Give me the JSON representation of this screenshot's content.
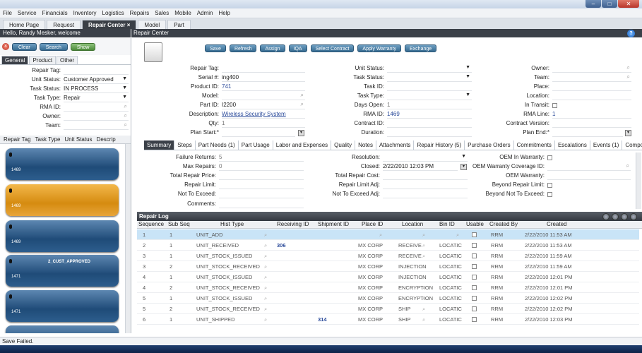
{
  "window": {
    "min": "–",
    "max": "□",
    "close": "✕"
  },
  "menu": [
    "File",
    "Service",
    "Financials",
    "Inventory",
    "Logistics",
    "Repairs",
    "Sales",
    "Mobile",
    "Admin",
    "Help"
  ],
  "tabs": [
    {
      "label": "Home Page"
    },
    {
      "label": "Request"
    },
    {
      "label": "Repair Center"
    },
    {
      "label": "Model"
    },
    {
      "label": "Part"
    }
  ],
  "tab_close": "×",
  "left_header": "Hello, Randy Mesker, welcome",
  "right_header": "Repair Center",
  "left_buttons": {
    "clear": "Clear",
    "search": "Search",
    "show": "Show"
  },
  "left_tabs": [
    "General",
    "Product",
    "Other"
  ],
  "left_form": [
    {
      "label": "Repair Tag:",
      "value": ""
    },
    {
      "label": "Unit Status:",
      "value": "Customer Approved",
      "kind": "dropdown"
    },
    {
      "label": "Task Status:",
      "value": "IN PROCESS",
      "kind": "dropdown"
    },
    {
      "label": "Task Type:",
      "value": "Repair",
      "kind": "dropdown"
    },
    {
      "label": "RMA ID:",
      "value": "",
      "kind": "lookup"
    },
    {
      "label": "Owner:",
      "value": "",
      "kind": "lookup"
    },
    {
      "label": "Team:",
      "value": "",
      "kind": "lookup"
    }
  ],
  "left_grid_cols": [
    "Repair Tag",
    "Task Type",
    "Unit Status",
    "Descrip"
  ],
  "cards": [
    {
      "id": "1469",
      "title": "",
      "color": "blue"
    },
    {
      "id": "1469",
      "title": "",
      "color": "orange"
    },
    {
      "id": "1469",
      "title": "",
      "color": "blue"
    },
    {
      "id": "1471",
      "title": "2_CUST_APPROVED",
      "color": "blue"
    },
    {
      "id": "1471",
      "title": "",
      "color": "blue"
    }
  ],
  "toolbar": [
    "Save",
    "Refresh",
    "Assign",
    "IQA",
    "Select Contract",
    "Apply Warranty",
    "Exchange"
  ],
  "form_left": {
    "repair_tag": {
      "label": "Repair Tag:",
      "value": ""
    },
    "serial": {
      "label": "Serial #:",
      "value": "ing400"
    },
    "product_id": {
      "label": "Product ID:",
      "value": "741"
    },
    "model": {
      "label": "Model:",
      "value": ""
    },
    "part_id": {
      "label": "Part ID:",
      "value": "I2200"
    },
    "description": {
      "label": "Description:",
      "value": "Wireless Security System"
    },
    "qty": {
      "label": "Qty:",
      "value": "1"
    },
    "plan_start": {
      "label": "Plan Start:*",
      "value": ""
    }
  },
  "form_mid": {
    "unit_status": {
      "label": "Unit Status:",
      "value": ""
    },
    "task_status": {
      "label": "Task Status:",
      "value": ""
    },
    "task_id": {
      "label": "Task ID:",
      "value": ""
    },
    "task_type": {
      "label": "Task Type:",
      "value": ""
    },
    "days_open": {
      "label": "Days Open:",
      "value": "1"
    },
    "rma_id": {
      "label": "RMA ID:",
      "value": "1469"
    },
    "contract_id": {
      "label": "Contract ID:",
      "value": ""
    },
    "duration": {
      "label": "Duration:",
      "value": ""
    }
  },
  "form_right": {
    "owner": {
      "label": "Owner:",
      "value": ""
    },
    "team": {
      "label": "Team:",
      "value": ""
    },
    "place": {
      "label": "Place:",
      "value": ""
    },
    "location": {
      "label": "Location:",
      "value": ""
    },
    "in_transit": {
      "label": "In Transit:",
      "value": ""
    },
    "rma_line": {
      "label": "RMA Line:",
      "value": "1"
    },
    "contract_version": {
      "label": "Contract Version:",
      "value": ""
    },
    "plan_end": {
      "label": "Plan End:*",
      "value": ""
    }
  },
  "summary_tabs": [
    "Summary",
    "Steps",
    "Part Needs (1)",
    "Part Usage",
    "Labor and Expenses",
    "Quality",
    "Notes",
    "Attachments",
    "Repair History (5)",
    "Purchase Orders",
    "Commitments",
    "Escalations",
    "Events (1)",
    "Compo"
  ],
  "summary": {
    "failure_returns": {
      "label": "Failure Returns:",
      "value": "5"
    },
    "max_repairs": {
      "label": "Max Repairs:",
      "value": "0"
    },
    "total_repair_price": {
      "label": "Total Repair Price:",
      "value": ""
    },
    "repair_limit": {
      "label": "Repair Limit:",
      "value": ""
    },
    "not_to_exceed": {
      "label": "Not To Exceed:",
      "value": ""
    },
    "comments": {
      "label": "Comments:",
      "value": ""
    },
    "resolution": {
      "label": "Resolution:",
      "value": ""
    },
    "closed": {
      "label": "Closed:",
      "value": "2/22/2010 12:03 PM"
    },
    "total_repair_cost": {
      "label": "Total Repair Cost:",
      "value": ""
    },
    "repair_limit_adj": {
      "label": "Repair Limit Adj:",
      "value": ""
    },
    "not_to_exceed_adj": {
      "label": "Not To Exceed Adj:",
      "value": ""
    },
    "oem_in_warranty": {
      "label": "OEM In Warranty:",
      "value": ""
    },
    "oem_warranty_coverage": {
      "label": "OEM Warranty Coverage ID:",
      "value": ""
    },
    "oem_warranty": {
      "label": "OEM Warranty:",
      "value": ""
    },
    "beyond_repair_limit": {
      "label": "Beyond Repair Limit:",
      "value": ""
    },
    "beyond_not_to_exceed": {
      "label": "Beyond Not To Exceed:",
      "value": ""
    }
  },
  "repair_log": {
    "title": "Repair Log",
    "columns": [
      "Sequence",
      "Sub Seq",
      "Hist Type",
      "Receiving ID",
      "Shipment ID",
      "Place ID",
      "Location",
      "Bin ID",
      "Usable",
      "Created By",
      "Created"
    ],
    "rows": [
      [
        "1",
        "1",
        "UNIT_ADD",
        "",
        "",
        "",
        "",
        "",
        "",
        "RRM",
        "2/22/2010 11:53 AM"
      ],
      [
        "2",
        "1",
        "UNIT_RECEIVED",
        "306",
        "",
        "MX CORP",
        "RECEIVE",
        "LOCATIC",
        "",
        "RRM",
        "2/22/2010 11:53 AM"
      ],
      [
        "3",
        "1",
        "UNIT_STOCK_ISSUED",
        "",
        "",
        "MX CORP",
        "RECEIVE",
        "LOCATIC",
        "",
        "RRM",
        "2/22/2010 11:59 AM"
      ],
      [
        "3",
        "2",
        "UNIT_STOCK_RECEIVED",
        "",
        "",
        "MX CORP",
        "INJECTION",
        "LOCATIC",
        "",
        "RRM",
        "2/22/2010 11:59 AM"
      ],
      [
        "4",
        "1",
        "UNIT_STOCK_ISSUED",
        "",
        "",
        "MX CORP",
        "INJECTION",
        "LOCATIC",
        "",
        "RRM",
        "2/22/2010 12:01 PM"
      ],
      [
        "4",
        "2",
        "UNIT_STOCK_RECEIVED",
        "",
        "",
        "MX CORP",
        "ENCRYPTION",
        "LOCATIC",
        "",
        "RRM",
        "2/22/2010 12:01 PM"
      ],
      [
        "5",
        "1",
        "UNIT_STOCK_ISSUED",
        "",
        "",
        "MX CORP",
        "ENCRYPTION",
        "LOCATIC",
        "",
        "RRM",
        "2/22/2010 12:02 PM"
      ],
      [
        "5",
        "2",
        "UNIT_STOCK_RECEIVED",
        "",
        "",
        "MX CORP",
        "SHIP",
        "LOCATIC",
        "",
        "RRM",
        "2/22/2010 12:02 PM"
      ],
      [
        "6",
        "1",
        "UNIT_SHIPPED",
        "",
        "314",
        "MX CORP",
        "SHIP",
        "LOCATIC",
        "",
        "RRM",
        "2/22/2010 12:03 PM"
      ]
    ]
  },
  "status": "Save Failed."
}
